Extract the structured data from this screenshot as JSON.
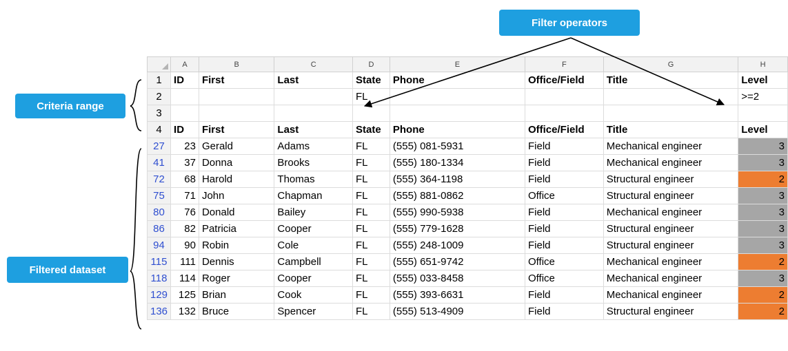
{
  "callouts": {
    "filter_operators": "Filter operators",
    "criteria_range": "Criteria range",
    "filtered_dataset": "Filtered dataset"
  },
  "columns": [
    "A",
    "B",
    "C",
    "D",
    "E",
    "F",
    "G",
    "H"
  ],
  "criteria": {
    "header_row_number": "1",
    "headers": [
      "ID",
      "First",
      "Last",
      "State",
      "Phone",
      "Office/Field",
      "Title",
      "Level"
    ],
    "condition_row_number": "2",
    "conditions": [
      "",
      "",
      "",
      "FL",
      "",
      "",
      "",
      ">=2"
    ],
    "blank_row_number": "3"
  },
  "dataset": {
    "header_row_number": "4",
    "headers": [
      "ID",
      "First",
      "Last",
      "State",
      "Phone",
      "Office/Field",
      "Title",
      "Level"
    ],
    "rows": [
      {
        "row": "27",
        "id": "23",
        "first": "Gerald",
        "last": "Adams",
        "state": "FL",
        "phone": "(555) 081-5931",
        "office": "Field",
        "title": "Mechanical engineer",
        "level": "3"
      },
      {
        "row": "41",
        "id": "37",
        "first": "Donna",
        "last": "Brooks",
        "state": "FL",
        "phone": "(555) 180-1334",
        "office": "Field",
        "title": "Mechanical engineer",
        "level": "3"
      },
      {
        "row": "72",
        "id": "68",
        "first": "Harold",
        "last": "Thomas",
        "state": "FL",
        "phone": "(555) 364-1198",
        "office": "Field",
        "title": "Structural engineer",
        "level": "2"
      },
      {
        "row": "75",
        "id": "71",
        "first": "John",
        "last": "Chapman",
        "state": "FL",
        "phone": "(555) 881-0862",
        "office": "Office",
        "title": "Structural engineer",
        "level": "3"
      },
      {
        "row": "80",
        "id": "76",
        "first": "Donald",
        "last": "Bailey",
        "state": "FL",
        "phone": "(555) 990-5938",
        "office": "Field",
        "title": "Mechanical engineer",
        "level": "3"
      },
      {
        "row": "86",
        "id": "82",
        "first": "Patricia",
        "last": "Cooper",
        "state": "FL",
        "phone": "(555) 779-1628",
        "office": "Field",
        "title": "Structural engineer",
        "level": "3"
      },
      {
        "row": "94",
        "id": "90",
        "first": "Robin",
        "last": "Cole",
        "state": "FL",
        "phone": "(555) 248-1009",
        "office": "Field",
        "title": "Structural engineer",
        "level": "3"
      },
      {
        "row": "115",
        "id": "111",
        "first": "Dennis",
        "last": "Campbell",
        "state": "FL",
        "phone": "(555) 651-9742",
        "office": "Office",
        "title": "Mechanical engineer",
        "level": "2"
      },
      {
        "row": "118",
        "id": "114",
        "first": "Roger",
        "last": "Cooper",
        "state": "FL",
        "phone": "(555) 033-8458",
        "office": "Office",
        "title": "Mechanical engineer",
        "level": "3"
      },
      {
        "row": "129",
        "id": "125",
        "first": "Brian",
        "last": "Cook",
        "state": "FL",
        "phone": "(555) 393-6631",
        "office": "Field",
        "title": "Mechanical engineer",
        "level": "2"
      },
      {
        "row": "136",
        "id": "132",
        "first": "Bruce",
        "last": "Spencer",
        "state": "FL",
        "phone": "(555) 513-4909",
        "office": "Field",
        "title": "Structural engineer",
        "level": "2"
      }
    ]
  },
  "colors": {
    "callout": "#1e9fe0",
    "level_3_fill": "#a6a6a6",
    "level_2_fill": "#ed7d31",
    "filtered_row_number": "#2f4fd0"
  }
}
